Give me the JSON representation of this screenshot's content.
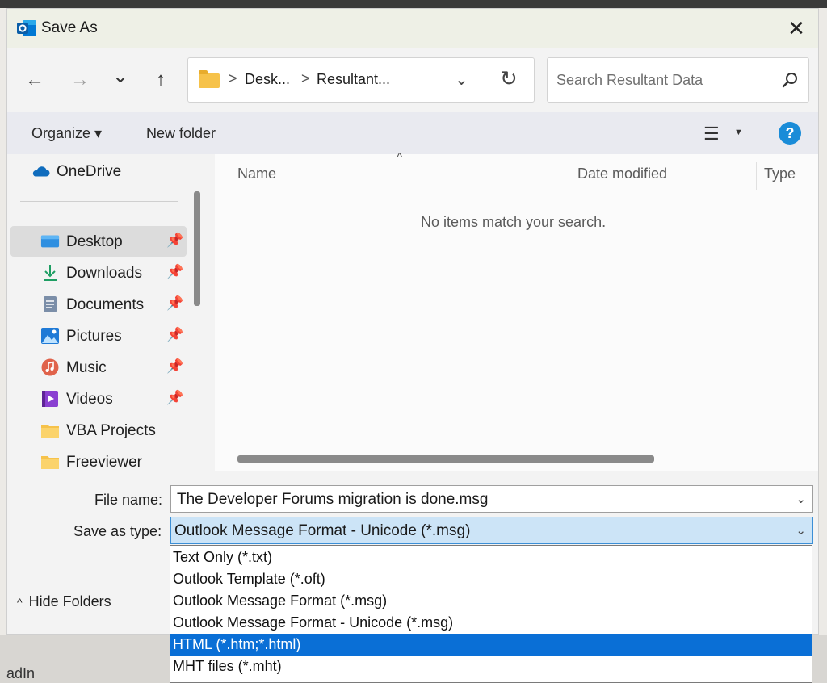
{
  "window": {
    "title": "Save As",
    "close_glyph": "✕"
  },
  "nav": {
    "back": "←",
    "forward": "→",
    "recent": "⌄",
    "up": "↑",
    "address": {
      "segments": [
        "Desk...",
        "Resultant..."
      ],
      "separator": ">",
      "dropdown": "⌄",
      "refresh": "↻"
    },
    "search": {
      "placeholder": "Search Resultant Data"
    }
  },
  "toolbar": {
    "organize": "Organize ▾",
    "new_folder": "New folder",
    "view_glyph": "☰",
    "view_dropdown": "▼",
    "help": "?"
  },
  "sidebar": {
    "items": [
      {
        "label": "OneDrive",
        "icon": "cloud-icon",
        "pinned": false
      },
      {
        "label": "Desktop",
        "icon": "desktop-icon",
        "pinned": true,
        "selected": true
      },
      {
        "label": "Downloads",
        "icon": "download-icon",
        "pinned": true
      },
      {
        "label": "Documents",
        "icon": "document-icon",
        "pinned": true
      },
      {
        "label": "Pictures",
        "icon": "picture-icon",
        "pinned": true
      },
      {
        "label": "Music",
        "icon": "music-icon",
        "pinned": true
      },
      {
        "label": "Videos",
        "icon": "video-icon",
        "pinned": true
      },
      {
        "label": "VBA Projects",
        "icon": "folder-icon",
        "pinned": false
      },
      {
        "label": "Freeviewer",
        "icon": "folder-icon",
        "pinned": false
      }
    ],
    "pin_glyph": "📌"
  },
  "filelist": {
    "columns": [
      "Name",
      "Date modified",
      "Type"
    ],
    "sort_caret": "^",
    "empty_message": "No items match your search."
  },
  "form": {
    "file_name_label": "File name:",
    "file_name_value": "The Developer Forums migration is done.msg",
    "save_type_label": "Save as type:",
    "save_type_value": "Outlook Message Format - Unicode (*.msg)",
    "dropdown_glyph": "⌄",
    "hide_folders": "Hide Folders",
    "hide_folders_glyph": "^"
  },
  "type_options": [
    {
      "label": "Text Only (*.txt)",
      "selected": false
    },
    {
      "label": "Outlook Template (*.oft)",
      "selected": false
    },
    {
      "label": "Outlook Message Format (*.msg)",
      "selected": false
    },
    {
      "label": "Outlook Message Format - Unicode (*.msg)",
      "selected": false
    },
    {
      "label": "HTML (*.htm;*.html)",
      "selected": true
    },
    {
      "label": "MHT files (*.mht)",
      "selected": false
    }
  ],
  "background": {
    "behind_text": "adIn"
  },
  "colors": {
    "accent": "#0a6fd6",
    "selection_bg": "#cce4f7",
    "help_blue": "#1a8cd8"
  }
}
